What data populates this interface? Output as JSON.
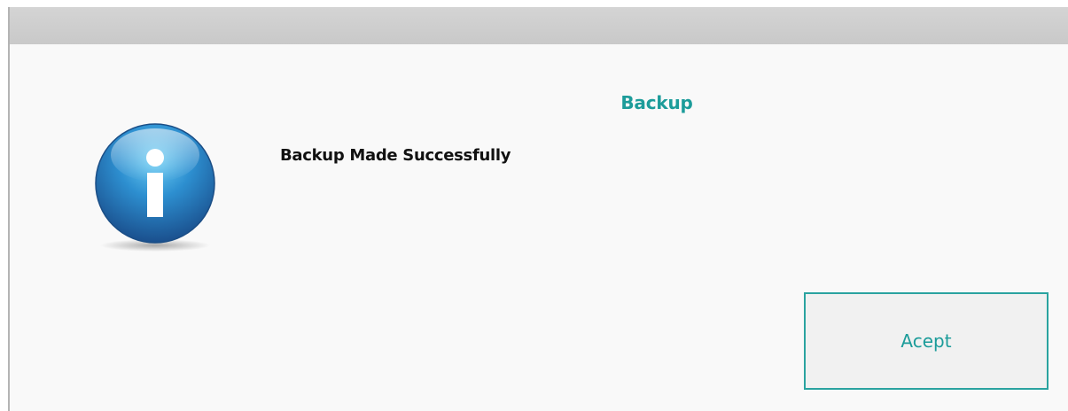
{
  "dialog": {
    "title": "Backup",
    "message": "Backup Made Successfully",
    "icon": "info-icon",
    "accent_color": "#1c9c9a",
    "accept_label": "Acept"
  }
}
